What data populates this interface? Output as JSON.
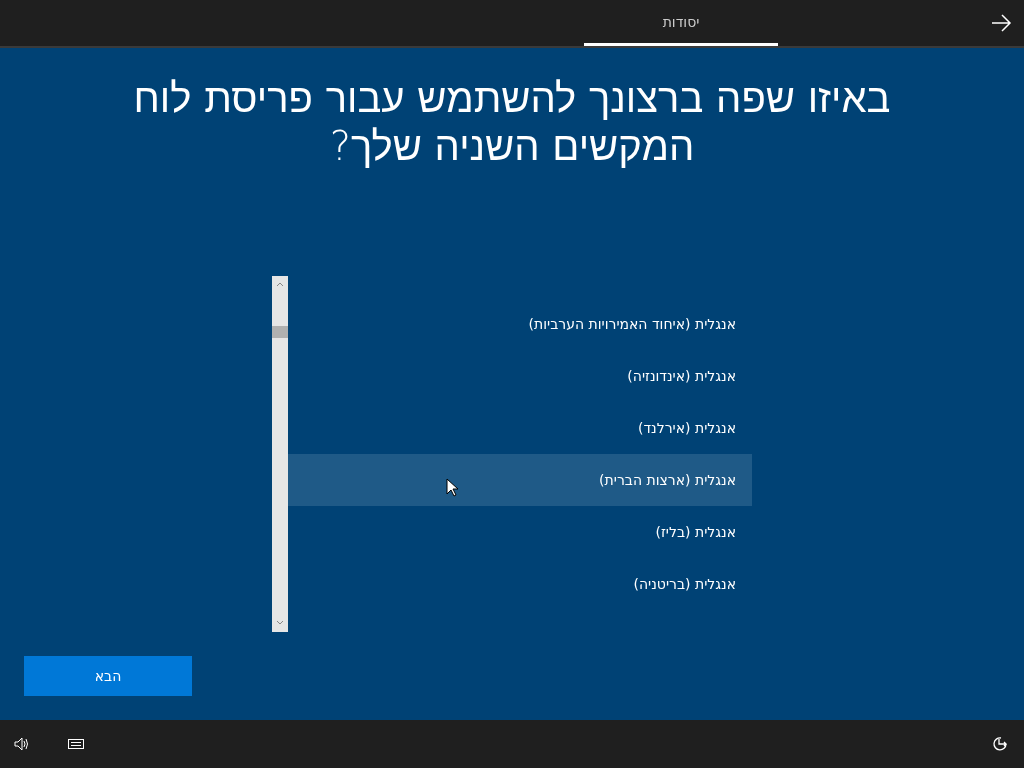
{
  "top_bar": {
    "tabs": [
      {
        "label": "יסודות",
        "selected": true
      }
    ]
  },
  "title": "באיזו שפה ברצונך להשתמש עבור פריסת לוח המקשים השניה שלך?",
  "languages": [
    {
      "label": "אנגלית (איחוד האמירויות הערביות)",
      "selected": false
    },
    {
      "label": "אנגלית (אינדונזיה)",
      "selected": false
    },
    {
      "label": "אנגלית (אירלנד)",
      "selected": false
    },
    {
      "label": "אנגלית (ארצות הברית)",
      "selected": true
    },
    {
      "label": "אנגלית (בליז)",
      "selected": false
    },
    {
      "label": "אנגלית (בריטניה)",
      "selected": false
    }
  ],
  "next_button": "הבא"
}
